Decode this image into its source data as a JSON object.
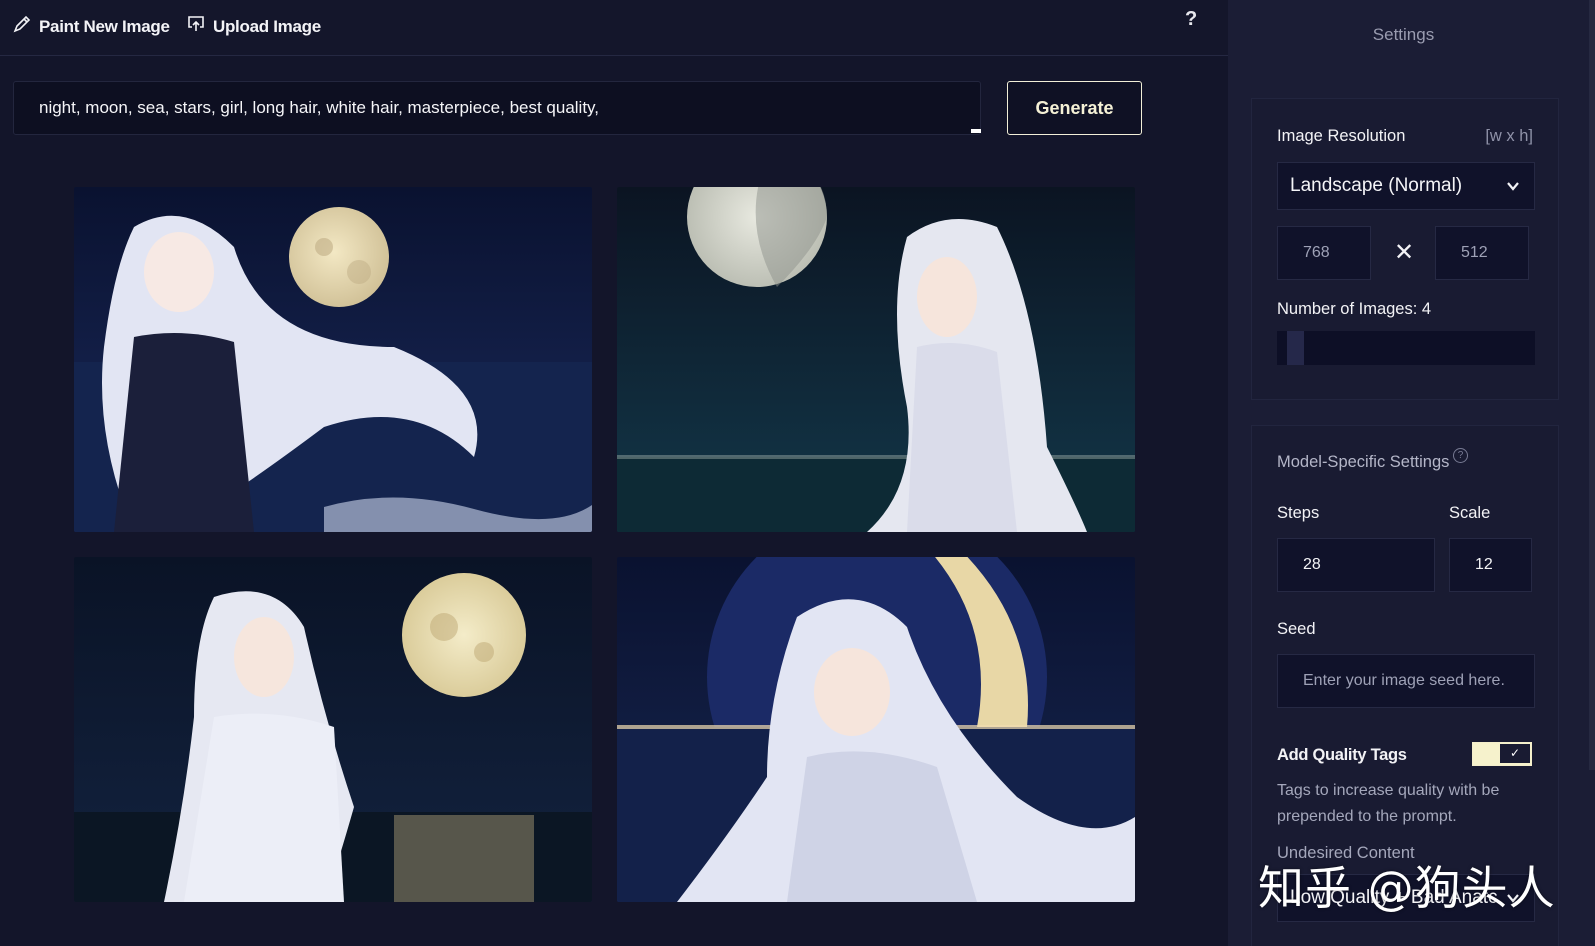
{
  "toolbar": {
    "paint_label": "Paint New Image",
    "upload_label": "Upload Image",
    "help_label": "?"
  },
  "prompt": {
    "value": "night, moon, sea, stars, girl, long hair, white hair, masterpiece, best quality,"
  },
  "generate_label": "Generate",
  "images": [
    {
      "scene": "dark-dress-girl-full-moon-sea"
    },
    {
      "scene": "white-dress-girl-crescent-moon"
    },
    {
      "scene": "robe-girl-full-moon-reflection"
    },
    {
      "scene": "smiling-girl-large-moon-sea"
    }
  ],
  "settings": {
    "title": "Settings",
    "resolution": {
      "label": "Image Resolution",
      "hint": "[w x h]",
      "preset": "Landscape (Normal)",
      "width": "768",
      "times": "✕",
      "height": "512"
    },
    "num_images": {
      "label": "Number of Images:",
      "value": "4",
      "level": 0.04
    },
    "model": {
      "title": "Model-Specific Settings",
      "help_icon": "?",
      "steps_label": "Steps",
      "steps_value": "28",
      "scale_label": "Scale",
      "scale_value": "12",
      "seed_label": "Seed",
      "seed_placeholder": "Enter your image seed here.",
      "quality_label": "Add Quality Tags",
      "quality_enabled": true,
      "quality_check": "✓",
      "quality_desc": "Tags to increase quality with be prepended to the prompt.",
      "undesired_label": "Undesired Content",
      "undesired_value": "Low Quality + Bad Anatc"
    }
  },
  "watermark": "知乎 @狗头人",
  "colors": {
    "background": "#13152a",
    "panel": "#1b1d35",
    "accent": "#f6f2cc"
  }
}
